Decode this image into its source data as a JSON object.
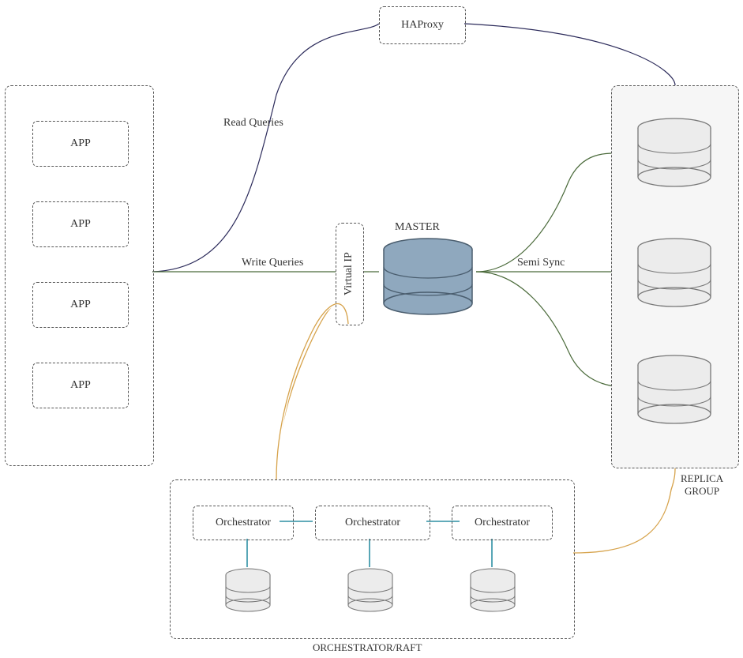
{
  "diagram": {
    "haproxy": {
      "label": "HAProxy"
    },
    "apps_group": {
      "items": [
        "APP",
        "APP",
        "APP",
        "APP"
      ]
    },
    "virtual_ip": {
      "label": "Virtual IP"
    },
    "master": {
      "label": "MASTER"
    },
    "replica_group": {
      "label": "REPLICA\nGROUP"
    },
    "orchestrator_group": {
      "label": "ORCHESTRATOR/RAFT",
      "items": [
        "Orchestrator",
        "Orchestrator",
        "Orchestrator"
      ]
    },
    "edges": {
      "read_queries": "Read Queries",
      "write_queries": "Write Queries",
      "semi_sync": "Semi Sync"
    },
    "colors": {
      "dashed": "#555555",
      "read_line": "#2b2a5a",
      "write_line": "#4a6a3a",
      "orch_line": "#d6a24a",
      "teal_line": "#2e8fa3",
      "master_fill": "#8fa8be",
      "master_stroke": "#4a5d6e",
      "replica_fill": "#ececec",
      "replica_stroke": "#777777",
      "replica_bg": "#f6f6f6"
    }
  }
}
